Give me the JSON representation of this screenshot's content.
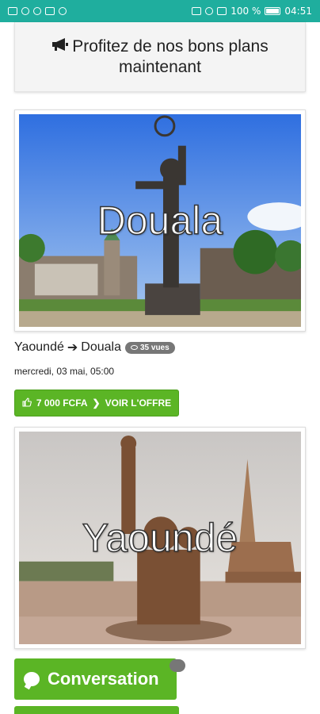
{
  "status_bar": {
    "battery_percent": "100 %",
    "time": "04:51"
  },
  "promo": {
    "text": "Profitez de nos bons plans maintenant",
    "icon": "megaphone-icon"
  },
  "offer": {
    "image_city": "Douala",
    "origin": "Yaoundé",
    "destination": "Douala",
    "views": "35 vues",
    "date": "mercredi, 03 mai, 05:00",
    "price": "7 000 FCFA",
    "cta": "VOIR L'OFFRE"
  },
  "next_card": {
    "image_city": "Yaoundé"
  },
  "conversation": {
    "label": "Conversation"
  },
  "colors": {
    "status_bar": "#1fae9e",
    "accent_green": "#5bb525",
    "badge_gray": "#777777"
  }
}
